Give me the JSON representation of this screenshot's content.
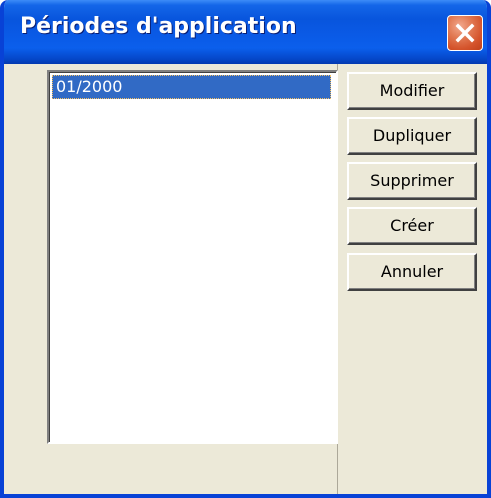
{
  "window": {
    "title": "Périodes d'application"
  },
  "periods_list": {
    "items": [
      "01/2000"
    ],
    "selected_index": 0
  },
  "buttons": {
    "modify": "Modifier",
    "duplicate": "Dupliquer",
    "delete": "Supprimer",
    "create": "Créer",
    "cancel": "Annuler"
  },
  "colors": {
    "titlebar": "#0a5ae6",
    "selection": "#316ac5",
    "face": "#ece9d8",
    "close_button": "#d4532b"
  },
  "icons": {
    "close": "close-x-icon"
  }
}
